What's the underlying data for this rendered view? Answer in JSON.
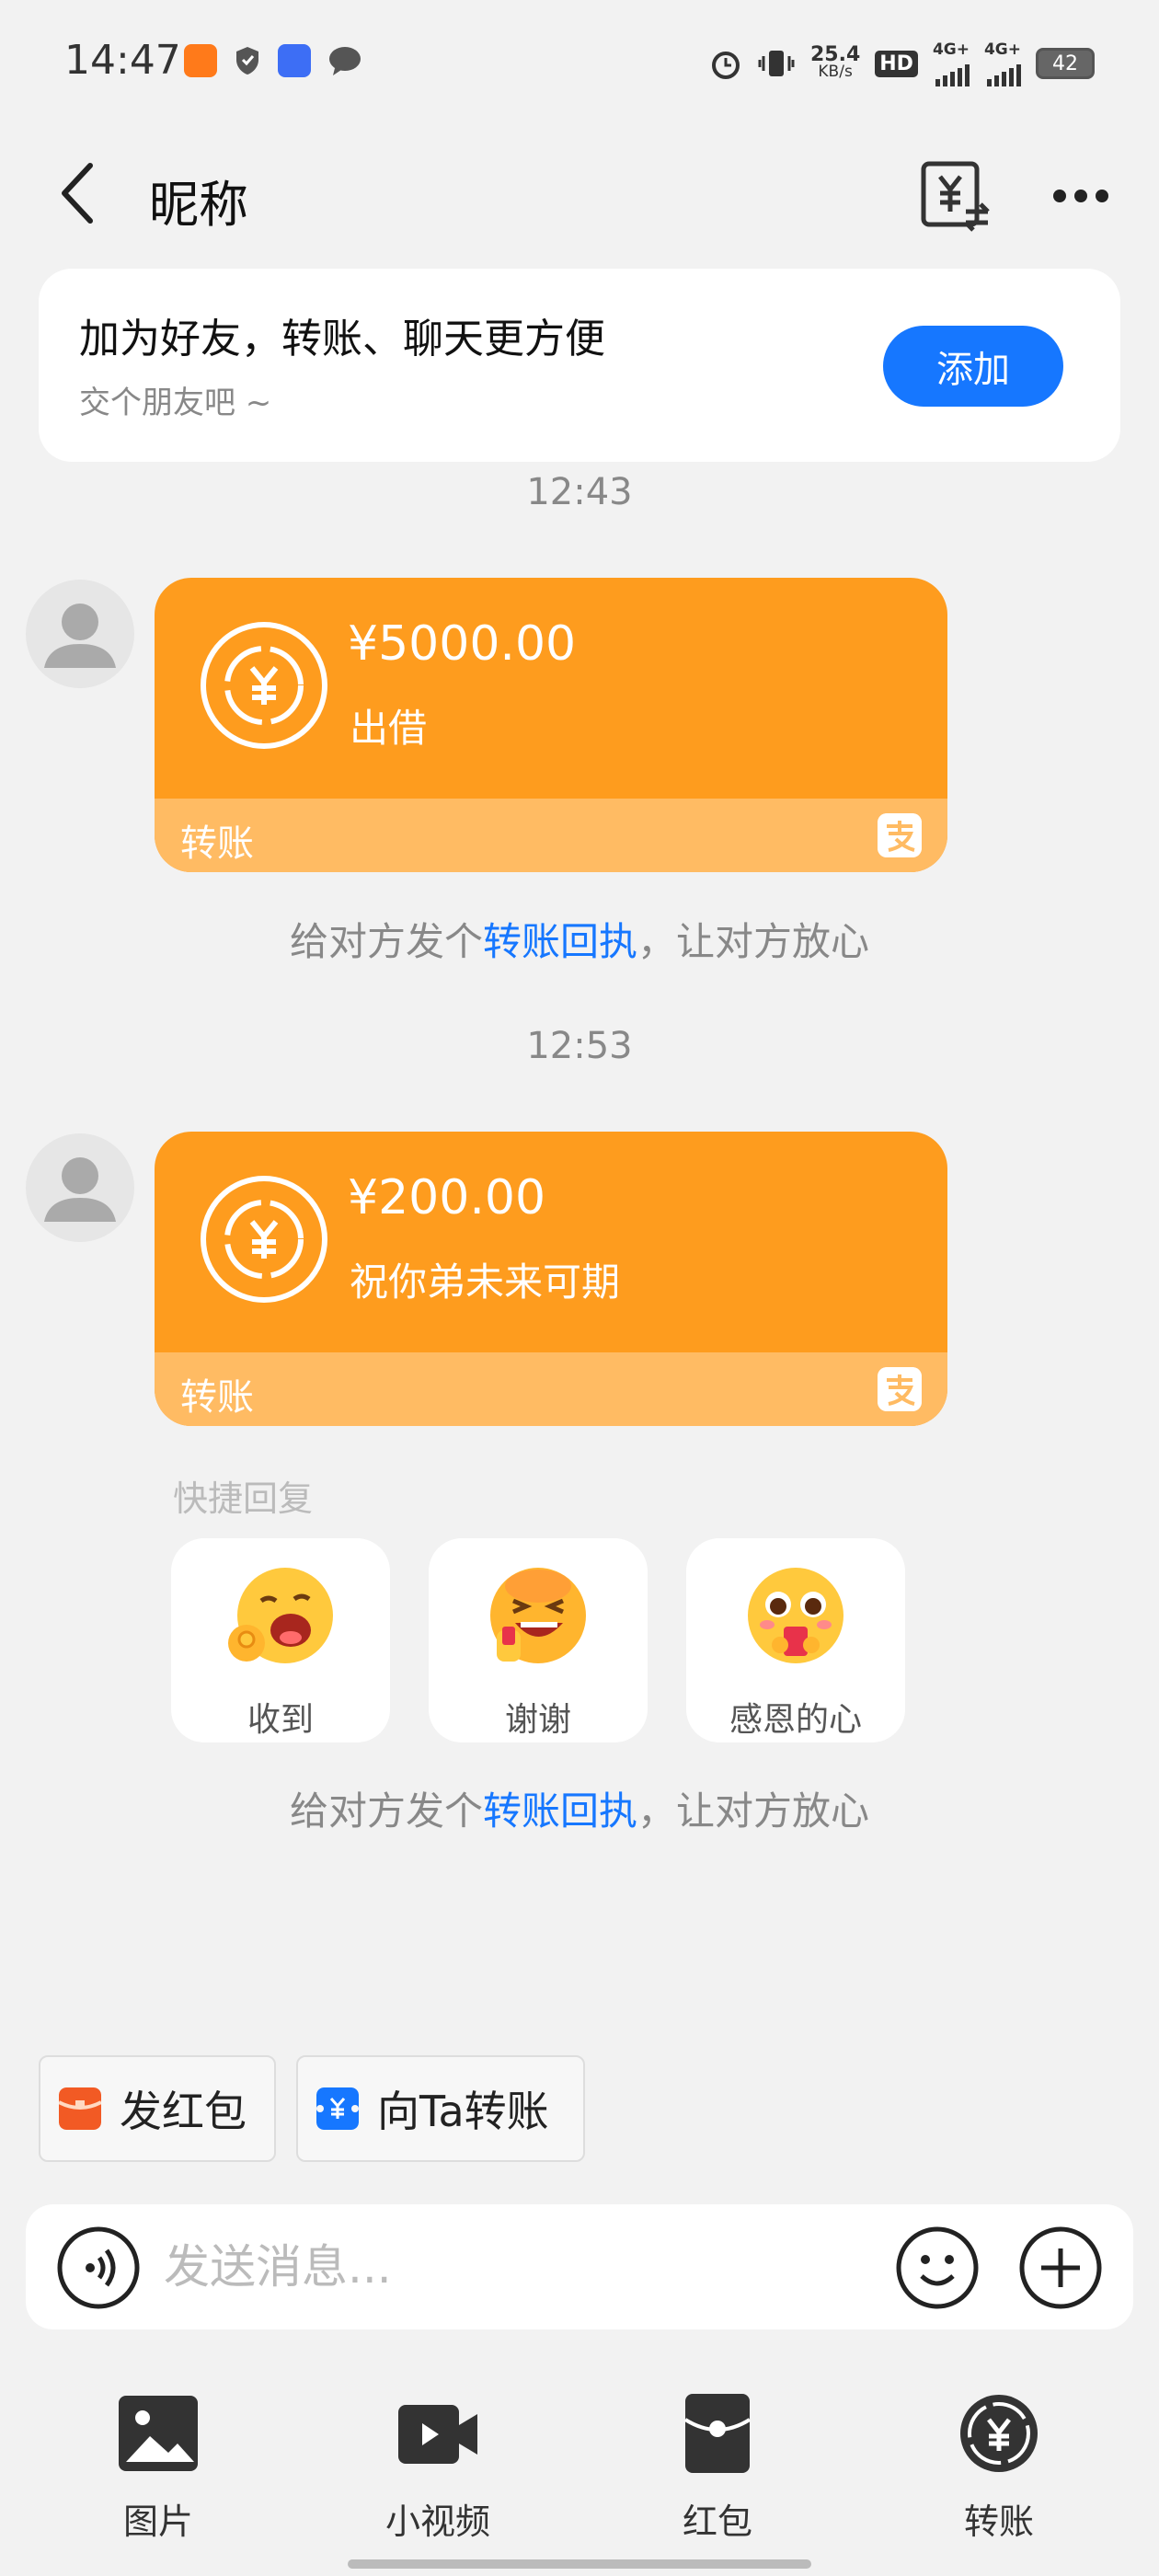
{
  "status_bar": {
    "time": "14:47",
    "net_speed_value": "25.4",
    "net_speed_unit": "KB/s",
    "hd_label": "HD",
    "network_1": "4G+",
    "network_2": "4G+",
    "battery": "42"
  },
  "header": {
    "title": "昵称"
  },
  "friend_card": {
    "title": "加为好友，转账、聊天更方便",
    "subtitle": "交个朋友吧 ~",
    "add_label": "添加"
  },
  "messages": [
    {
      "timestamp": "12:43",
      "amount": "¥5000.00",
      "memo": "出借",
      "type_label": "转账",
      "hint_prefix": "给对方发个",
      "hint_link": "转账回执",
      "hint_suffix": "，让对方放心"
    },
    {
      "timestamp": "12:53",
      "amount": "¥200.00",
      "memo": "祝你弟未来可期",
      "type_label": "转账"
    }
  ],
  "quick_reply": {
    "title": "快捷回复",
    "items": [
      {
        "label": "收到",
        "icon": "ok-emoji-icon"
      },
      {
        "label": "谢谢",
        "icon": "thanks-emoji-icon"
      },
      {
        "label": "感恩的心",
        "icon": "grateful-emoji-icon"
      }
    ],
    "hint_prefix": "给对方发个",
    "hint_link": "转账回执",
    "hint_suffix": "，让对方放心"
  },
  "shortcuts": {
    "red_packet": "发红包",
    "transfer": "向Ta转账"
  },
  "input": {
    "placeholder": "发送消息..."
  },
  "tools": [
    {
      "label": "图片",
      "icon": "image-icon"
    },
    {
      "label": "小视频",
      "icon": "video-icon"
    },
    {
      "label": "红包",
      "icon": "red-packet-icon"
    },
    {
      "label": "转账",
      "icon": "transfer-icon"
    }
  ],
  "colors": {
    "accent_blue": "#1677ff",
    "transfer_orange": "#fe9c1e",
    "transfer_footer": "#ffbb63",
    "background": "#f2f2f2"
  }
}
